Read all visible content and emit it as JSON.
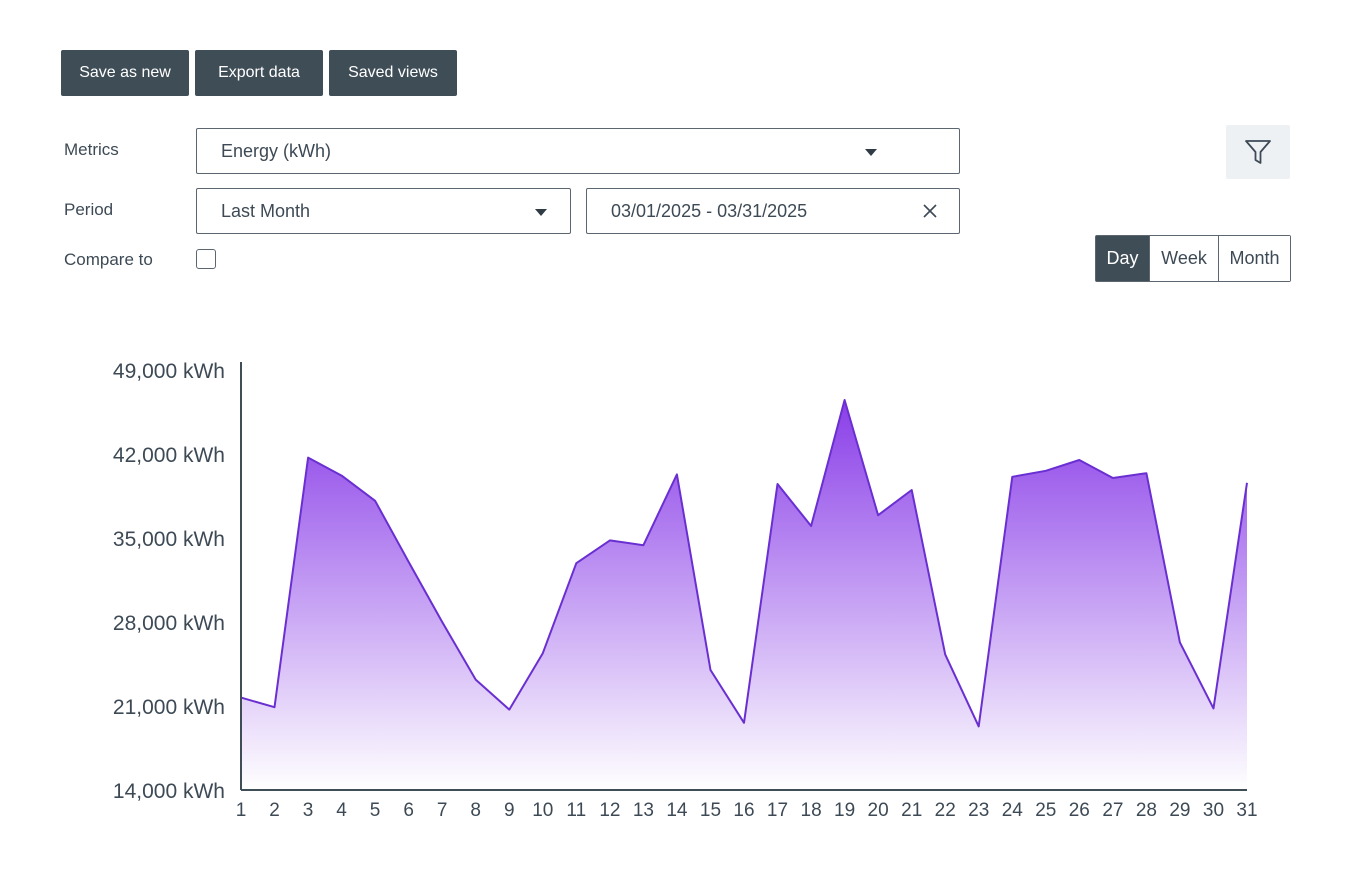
{
  "toolbar": {
    "save_as_new": "Save as new",
    "export_data": "Export data",
    "saved_views": "Saved views"
  },
  "filters": {
    "metrics_label": "Metrics",
    "metrics_value": "Energy (kWh)",
    "period_label": "Period",
    "period_value": "Last Month",
    "date_range": "03/01/2025 - 03/31/2025",
    "compare_label": "Compare to",
    "compare_checked": false
  },
  "granularity": {
    "options": [
      "Day",
      "Week",
      "Month"
    ],
    "selected": "Day"
  },
  "icons": {
    "filter": "filter-icon",
    "clear": "close-icon",
    "dropdown": "chevron-down-icon"
  },
  "colors": {
    "button_dark": "#3f4d57",
    "series_stroke": "#6a2fd1",
    "series_fill_top": "#8a3ee8",
    "series_fill_bottom": "#ffffff"
  },
  "chart_data": {
    "type": "area",
    "x": [
      "1",
      "2",
      "3",
      "4",
      "5",
      "6",
      "7",
      "8",
      "9",
      "10",
      "11",
      "12",
      "13",
      "14",
      "15",
      "16",
      "17",
      "18",
      "19",
      "20",
      "21",
      "22",
      "23",
      "24",
      "25",
      "26",
      "27",
      "28",
      "29",
      "30",
      "31"
    ],
    "series": [
      {
        "values": [
          21700,
          20900,
          41700,
          40200,
          38100,
          33000,
          28000,
          23200,
          20700,
          25400,
          32900,
          34800,
          34400,
          40300,
          24000,
          19600,
          39500,
          36000,
          46500,
          36900,
          39000,
          25300,
          19300,
          40100,
          40600,
          41500,
          40000,
          40400,
          26300,
          20800,
          39600
        ]
      }
    ],
    "ylim": [
      14000,
      49000
    ],
    "yticks": [
      "14,000 kWh",
      "21,000 kWh",
      "28,000 kWh",
      "35,000 kWh",
      "42,000 kWh",
      "49,000 kWh"
    ],
    "ytick_values": [
      14000,
      21000,
      28000,
      35000,
      42000,
      49000
    ],
    "grid": false
  }
}
